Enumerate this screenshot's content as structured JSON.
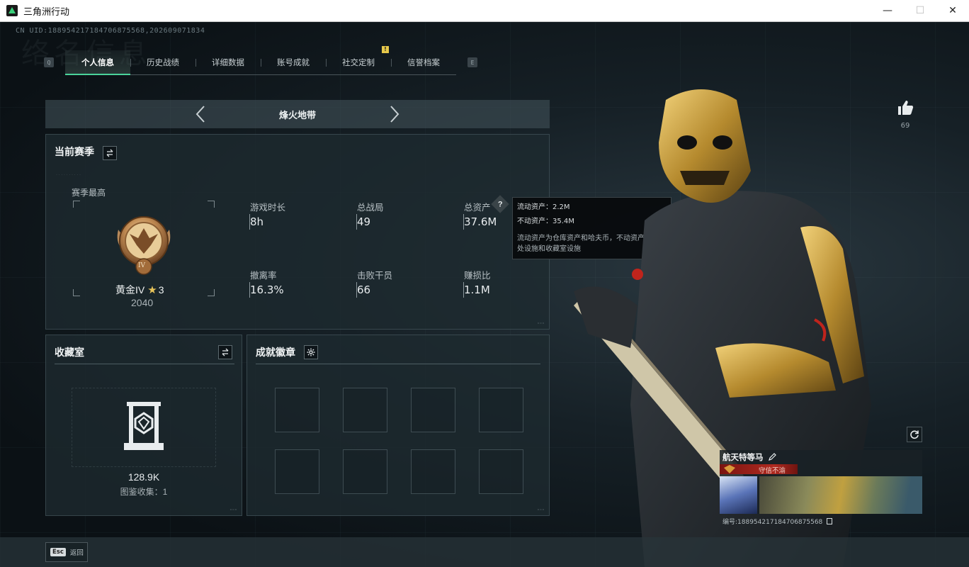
{
  "window": {
    "title": "三角洲行动",
    "minimize": "—",
    "maximize": "☐",
    "close": "✕"
  },
  "uid_text": "CN UID:1889542171847068755​68,202609071834",
  "watermark": "络名信息",
  "tabs": {
    "left_key": "Q",
    "right_key": "E",
    "items": [
      {
        "label": "个人信息"
      },
      {
        "label": "历史战绩"
      },
      {
        "label": "详细数据"
      },
      {
        "label": "账号成就"
      },
      {
        "label": "社交定制",
        "badge": "!"
      },
      {
        "label": "信誉档案"
      }
    ]
  },
  "map_selector": {
    "title": "烽火地带"
  },
  "season_panel": {
    "title": "当前赛季",
    "highest_label": "赛季最高",
    "rank_name": "黄金IV",
    "rank_stars": "3",
    "rank_points": "2040",
    "rank_numeral": "IV",
    "stats": [
      {
        "label": "游戏时长",
        "value": "8h"
      },
      {
        "label": "总战局",
        "value": "49"
      },
      {
        "label": "总资产",
        "value": "37.6M",
        "help": "?"
      },
      {
        "label": "撤离率",
        "value": "16.3%"
      },
      {
        "label": "击败干员",
        "value": "66"
      },
      {
        "label": "赚损比",
        "value": "1.1M"
      }
    ]
  },
  "tooltip": {
    "line1": "流动资产：2.2M",
    "line2": "不动资产：35.4M",
    "desc": "流动资产为仓库资产和哈夫币，不动资产为特勤处设施和收藏室设施"
  },
  "collection_panel": {
    "title": "收藏室",
    "value": "128.9K",
    "collect_label": "图鉴收集：",
    "collect_count": "1"
  },
  "achievement_panel": {
    "title": "成就徽章"
  },
  "like": {
    "count": "69"
  },
  "player_card": {
    "name": "航天特等马",
    "title": "守信不渝",
    "id_text": "编号:1889542171847068755​68"
  },
  "footer": {
    "esc_key": "Esc",
    "esc_label": "返回"
  },
  "colors": {
    "accent": "#4ad39a",
    "badge": "#e6c84a",
    "title_red": "#b02a20"
  }
}
